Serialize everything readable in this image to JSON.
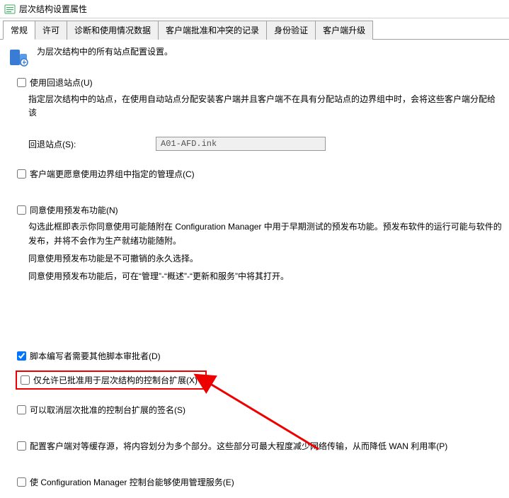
{
  "window": {
    "title": "层次结构设置属性"
  },
  "tabs": [
    {
      "label": "常规"
    },
    {
      "label": "许可"
    },
    {
      "label": "诊断和使用情况数据"
    },
    {
      "label": "客户端批准和冲突的记录"
    },
    {
      "label": "身份验证"
    },
    {
      "label": "客户端升级"
    }
  ],
  "header": {
    "desc": "为层次结构中的所有站点配置设置。"
  },
  "fallback": {
    "label": "使用回退站点(U)",
    "desc": "指定层次结构中的站点，在使用自动站点分配安装客户端并且客户端不在具有分配站点的边界组中时，会将这些客户端分配给该",
    "field_label": "回退站点(S):",
    "field_value": "A01-AFD.ink"
  },
  "client_pref": {
    "label": "客户端更愿意使用边界组中指定的管理点(C)"
  },
  "prerelease": {
    "label": "同意使用预发布功能(N)",
    "line1": "勾选此框即表示你同意使用可能随附在 Configuration Manager 中用于早期测试的预发布功能。预发布软件的运行可能与软件的",
    "line1b": "发布，并将不会作为生产就绪功能随附。",
    "line2": "同意使用预发布功能是不可撤销的永久选择。",
    "line3": "同意使用预发布功能后，可在“管理”-“概述”-“更新和服务”中将其打开。"
  },
  "script_approve": {
    "label": "脚本编写者需要其他脚本审批者(D)"
  },
  "hierarchy_ext": {
    "label": "仅允许已批准用于层次结构的控制台扩展(X)"
  },
  "revoke_sign": {
    "label": "可以取消层次批准的控制台扩展的签名(S)"
  },
  "peer_cache": {
    "label": "配置客户端对等缓存源，将内容划分为多个部分。这些部分可最大程度减少网络传输，从而降低 WAN 利用率(P)"
  },
  "admin_service": {
    "label": "使 Configuration Manager 控制台能够使用管理服务(E)"
  }
}
